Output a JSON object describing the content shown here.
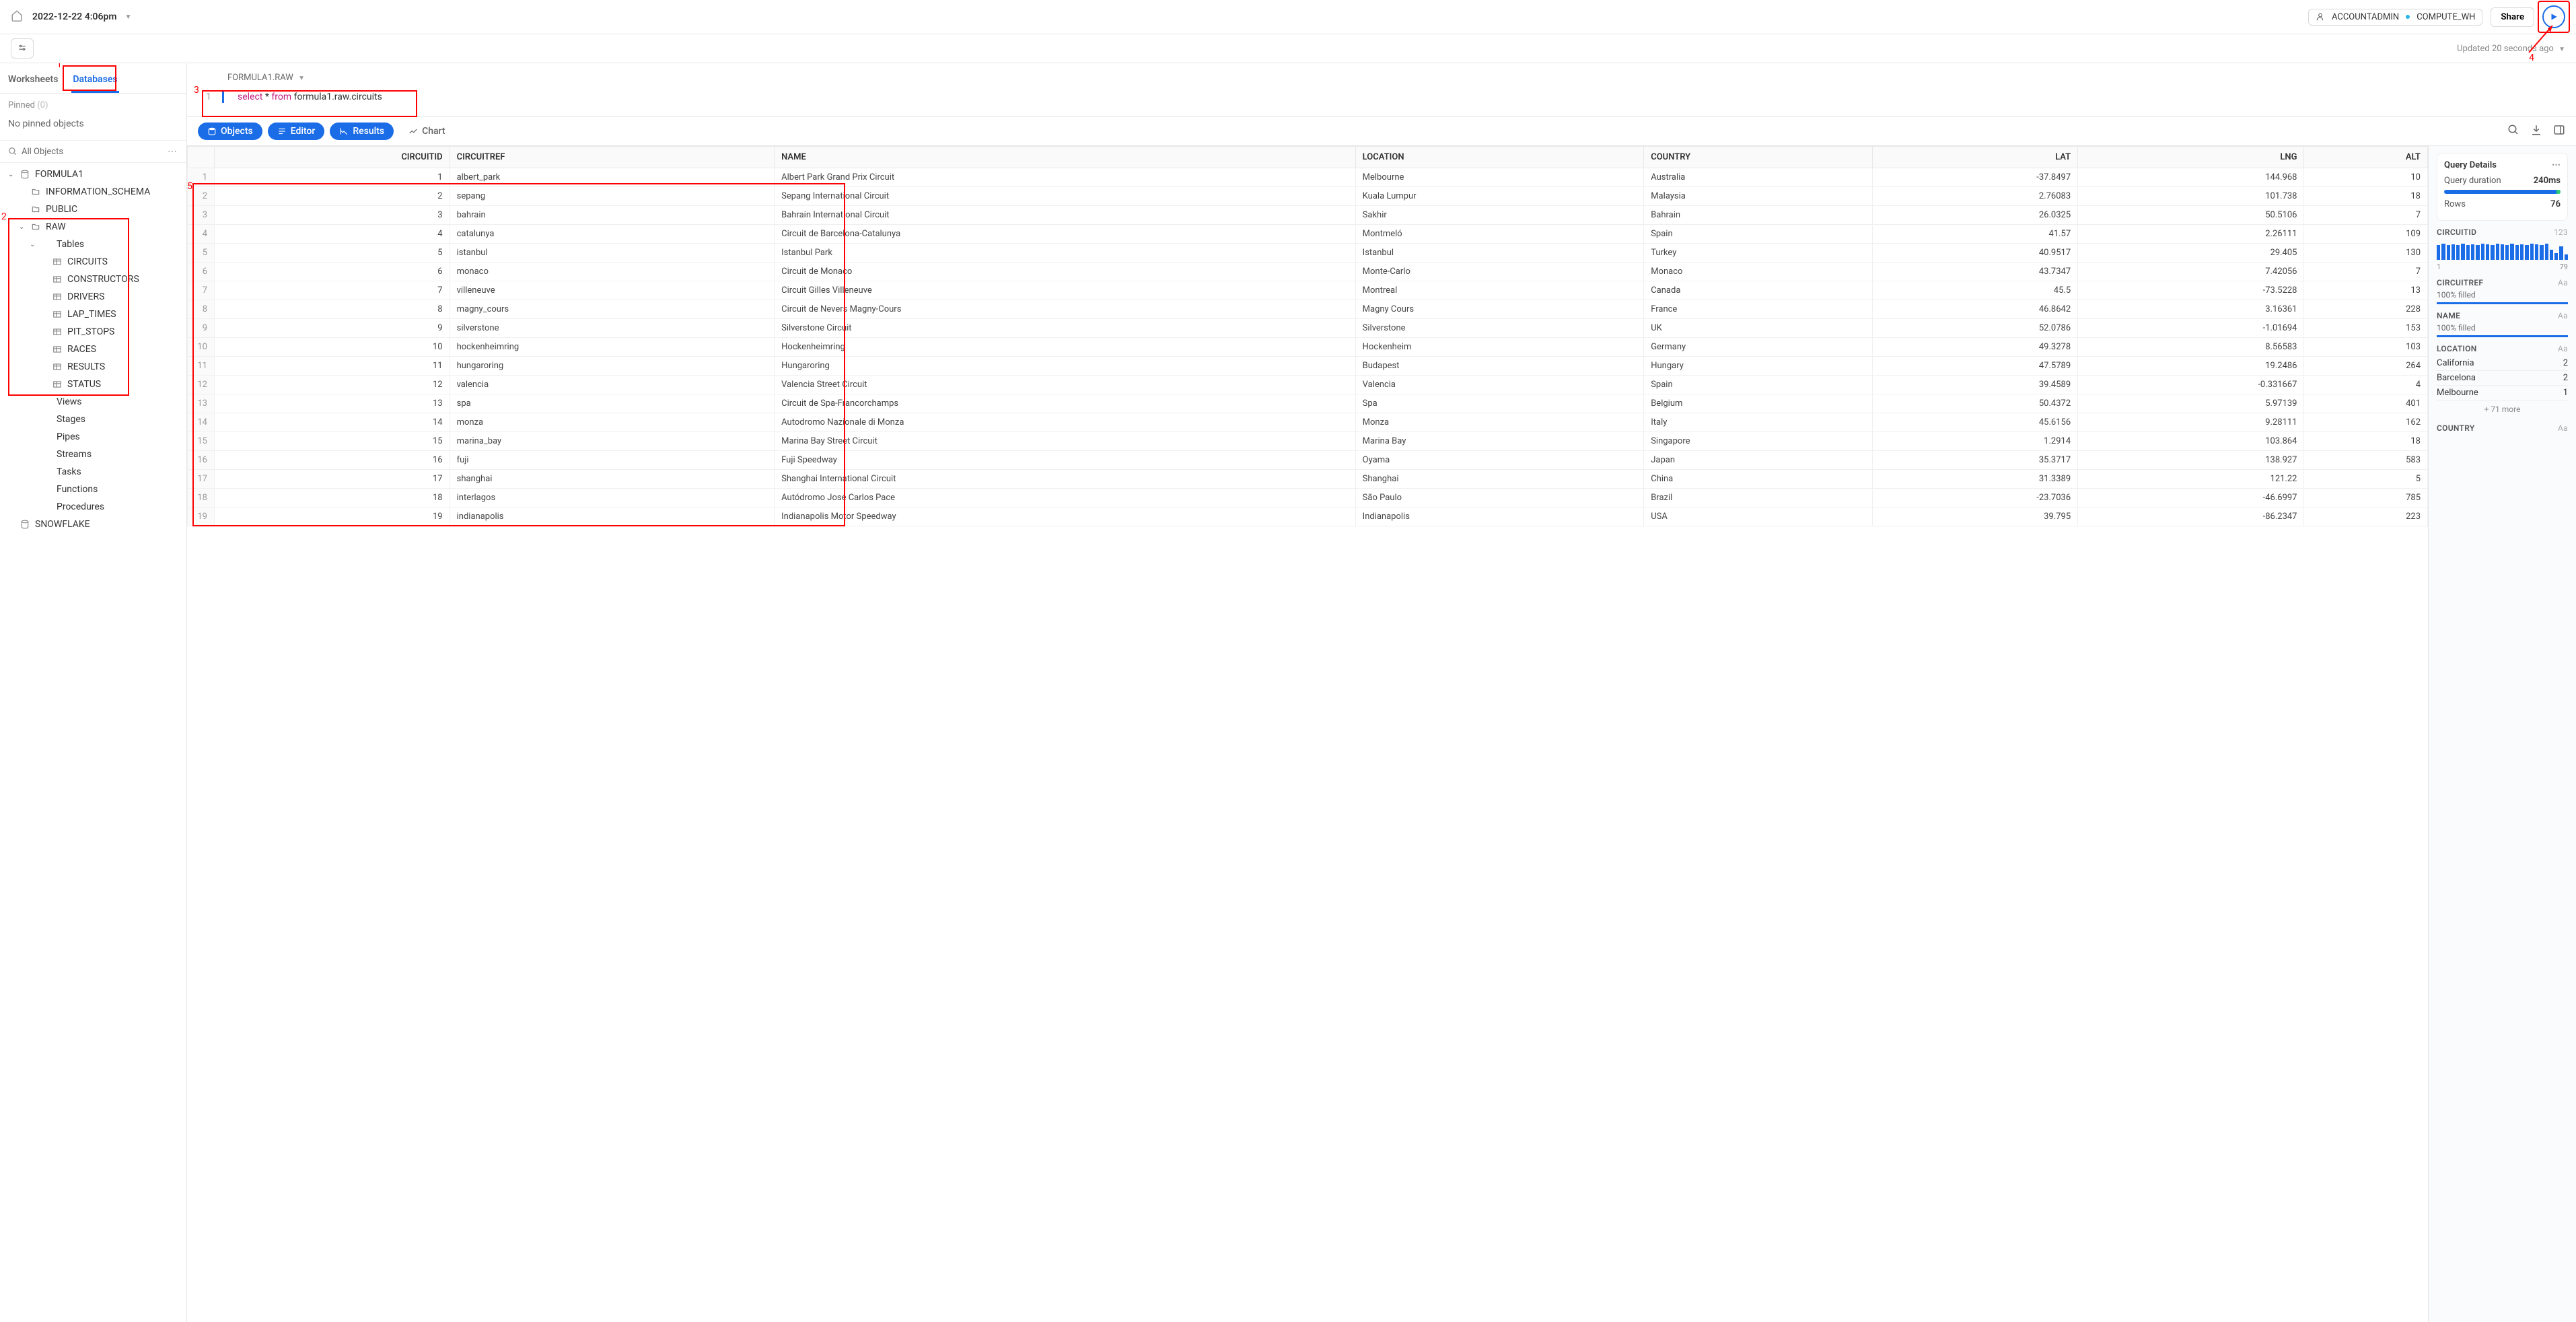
{
  "header": {
    "title": "2022-12-22 4:06pm",
    "role": "ACCOUNTADMIN",
    "warehouse": "COMPUTE_WH",
    "share": "Share",
    "updated": "Updated 20 seconds ago"
  },
  "sidebar": {
    "tabs": [
      "Worksheets",
      "Databases"
    ],
    "active_tab": 1,
    "pinned_label": "Pinned",
    "pinned_count": "(0)",
    "no_pinned": "No pinned objects",
    "all_objects": "All Objects",
    "tree": [
      {
        "label": "FORMULA1",
        "type": "db",
        "expanded": true,
        "children": [
          {
            "label": "INFORMATION_SCHEMA",
            "type": "schema",
            "expanded": false
          },
          {
            "label": "PUBLIC",
            "type": "schema",
            "expanded": false
          },
          {
            "label": "RAW",
            "type": "schema",
            "expanded": true,
            "children": [
              {
                "label": "Tables",
                "type": "folder",
                "expanded": true,
                "children": [
                  {
                    "label": "CIRCUITS",
                    "type": "table"
                  },
                  {
                    "label": "CONSTRUCTORS",
                    "type": "table"
                  },
                  {
                    "label": "DRIVERS",
                    "type": "table"
                  },
                  {
                    "label": "LAP_TIMES",
                    "type": "table"
                  },
                  {
                    "label": "PIT_STOPS",
                    "type": "table"
                  },
                  {
                    "label": "RACES",
                    "type": "table"
                  },
                  {
                    "label": "RESULTS",
                    "type": "table"
                  },
                  {
                    "label": "STATUS",
                    "type": "table"
                  }
                ]
              },
              {
                "label": "Views",
                "type": "folder",
                "expanded": false
              },
              {
                "label": "Stages",
                "type": "folder",
                "expanded": false
              },
              {
                "label": "Pipes",
                "type": "folder",
                "expanded": false
              },
              {
                "label": "Streams",
                "type": "folder",
                "expanded": false
              },
              {
                "label": "Tasks",
                "type": "folder",
                "expanded": false
              },
              {
                "label": "Functions",
                "type": "folder",
                "expanded": false
              },
              {
                "label": "Procedures",
                "type": "folder",
                "expanded": false
              }
            ]
          }
        ]
      },
      {
        "label": "SNOWFLAKE",
        "type": "db",
        "expanded": false
      }
    ]
  },
  "editor": {
    "breadcrumb": "FORMULA1.RAW",
    "line_no": "1",
    "tokens": [
      {
        "t": "select",
        "k": true
      },
      {
        "t": " * ",
        "k": false
      },
      {
        "t": "from",
        "k": true
      },
      {
        "t": " formula1.raw.circuits",
        "k": false
      }
    ]
  },
  "toolbar": {
    "objects": "Objects",
    "editor": "Editor",
    "results": "Results",
    "chart": "Chart"
  },
  "table": {
    "columns": [
      "CIRCUITID",
      "CIRCUITREF",
      "NAME",
      "LOCATION",
      "COUNTRY",
      "LAT",
      "LNG",
      "ALT"
    ],
    "numeric_cols": [
      0,
      5,
      6,
      7
    ],
    "rows": [
      [
        1,
        "albert_park",
        "Albert Park Grand Prix Circuit",
        "Melbourne",
        "Australia",
        "-37.8497",
        "144.968",
        10
      ],
      [
        2,
        "sepang",
        "Sepang International Circuit",
        "Kuala Lumpur",
        "Malaysia",
        "2.76083",
        "101.738",
        18
      ],
      [
        3,
        "bahrain",
        "Bahrain International Circuit",
        "Sakhir",
        "Bahrain",
        "26.0325",
        "50.5106",
        7
      ],
      [
        4,
        "catalunya",
        "Circuit de Barcelona-Catalunya",
        "Montmeló",
        "Spain",
        "41.57",
        "2.26111",
        109
      ],
      [
        5,
        "istanbul",
        "Istanbul Park",
        "Istanbul",
        "Turkey",
        "40.9517",
        "29.405",
        130
      ],
      [
        6,
        "monaco",
        "Circuit de Monaco",
        "Monte-Carlo",
        "Monaco",
        "43.7347",
        "7.42056",
        7
      ],
      [
        7,
        "villeneuve",
        "Circuit Gilles Villeneuve",
        "Montreal",
        "Canada",
        "45.5",
        "-73.5228",
        13
      ],
      [
        8,
        "magny_cours",
        "Circuit de Nevers Magny-Cours",
        "Magny Cours",
        "France",
        "46.8642",
        "3.16361",
        228
      ],
      [
        9,
        "silverstone",
        "Silverstone Circuit",
        "Silverstone",
        "UK",
        "52.0786",
        "-1.01694",
        153
      ],
      [
        10,
        "hockenheimring",
        "Hockenheimring",
        "Hockenheim",
        "Germany",
        "49.3278",
        "8.56583",
        103
      ],
      [
        11,
        "hungaroring",
        "Hungaroring",
        "Budapest",
        "Hungary",
        "47.5789",
        "19.2486",
        264
      ],
      [
        12,
        "valencia",
        "Valencia Street Circuit",
        "Valencia",
        "Spain",
        "39.4589",
        "-0.331667",
        4
      ],
      [
        13,
        "spa",
        "Circuit de Spa-Francorchamps",
        "Spa",
        "Belgium",
        "50.4372",
        "5.97139",
        401
      ],
      [
        14,
        "monza",
        "Autodromo Nazionale di Monza",
        "Monza",
        "Italy",
        "45.6156",
        "9.28111",
        162
      ],
      [
        15,
        "marina_bay",
        "Marina Bay Street Circuit",
        "Marina Bay",
        "Singapore",
        "1.2914",
        "103.864",
        18
      ],
      [
        16,
        "fuji",
        "Fuji Speedway",
        "Oyama",
        "Japan",
        "35.3717",
        "138.927",
        583
      ],
      [
        17,
        "shanghai",
        "Shanghai International Circuit",
        "Shanghai",
        "China",
        "31.3389",
        "121.22",
        5
      ],
      [
        18,
        "interlagos",
        "Autódromo José Carlos Pace",
        "São Paulo",
        "Brazil",
        "-23.7036",
        "-46.6997",
        785
      ],
      [
        19,
        "indianapolis",
        "Indianapolis Motor Speedway",
        "Indianapolis",
        "USA",
        "39.795",
        "-86.2347",
        223
      ]
    ]
  },
  "details": {
    "title": "Query Details",
    "duration_label": "Query duration",
    "duration": "240ms",
    "rows_label": "Rows",
    "rows": "76",
    "circuitid": {
      "label": "CIRCUITID",
      "count": "123",
      "min": "1",
      "max": "79"
    },
    "circuitref": {
      "label": "CIRCUITREF",
      "type": "Aa",
      "fill": "100% filled"
    },
    "name": {
      "label": "NAME",
      "type": "Aa",
      "fill": "100% filled"
    },
    "location": {
      "label": "LOCATION",
      "type": "Aa",
      "items": [
        [
          "California",
          "2"
        ],
        [
          "Barcelona",
          "2"
        ],
        [
          "Melbourne",
          "1"
        ]
      ],
      "more": "+ 71 more"
    },
    "country": {
      "label": "COUNTRY",
      "type": "Aa"
    }
  },
  "annotations": {
    "1": "1",
    "2": "2",
    "3": "3",
    "4": "4",
    "5": "5"
  }
}
